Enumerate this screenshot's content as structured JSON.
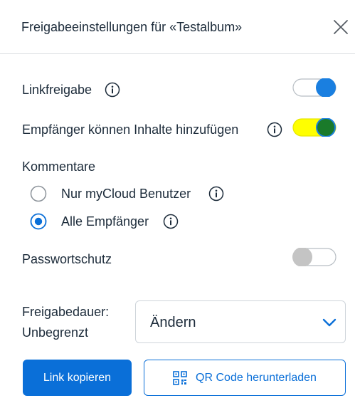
{
  "header": {
    "title": "Freigabeeinstellungen für «Testalbum»",
    "close_icon": "close-icon"
  },
  "link_sharing": {
    "label": "Linkfreigabe",
    "enabled": true
  },
  "recipients_add": {
    "label": "Empfänger können Inhalte hinzufügen",
    "enabled": true
  },
  "comments": {
    "label": "Kommentare",
    "options": [
      {
        "label": "Nur myCloud Benutzer",
        "selected": false
      },
      {
        "label": "Alle Empfänger",
        "selected": true
      }
    ]
  },
  "password_protection": {
    "label": "Passwortschutz",
    "enabled": false
  },
  "duration": {
    "label_line1": "Freigabedauer:",
    "label_line2": "Unbegrenzt",
    "dropdown_value": "Ändern"
  },
  "buttons": {
    "copy_link": "Link kopieren",
    "download_qr": "QR Code herunterladen"
  },
  "colors": {
    "accent": "#0a6fd8",
    "toggle_on": "#1a7fe0",
    "toggle_off": "#c4c4c4",
    "highlight": "#ffff00"
  }
}
